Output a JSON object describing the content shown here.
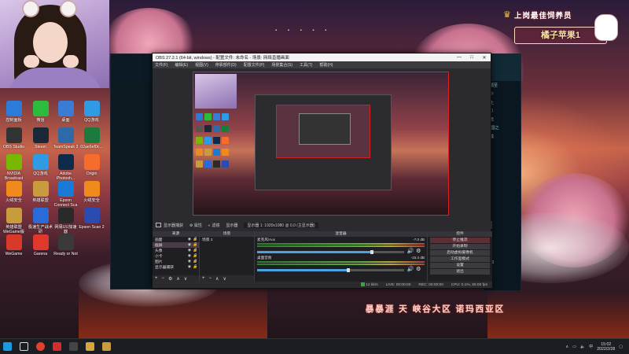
{
  "desktop": {
    "icons": [
      {
        "label": "控制面板",
        "icon": "control-panel-icon",
        "color": "#2b7bd8"
      },
      {
        "label": "微信",
        "icon": "wechat-icon",
        "color": "#2dbb3c"
      },
      {
        "label": "桌面",
        "icon": "desktop-icon",
        "color": "#3a7bd5"
      },
      {
        "label": "QQ游戏",
        "icon": "qq-game-icon",
        "color": "#2f9be4"
      },
      {
        "label": "OBS Studio",
        "icon": "obs-icon",
        "color": "#333333"
      },
      {
        "label": "Steam",
        "icon": "steam-icon",
        "color": "#1b2838"
      },
      {
        "label": "TeamSpeak 3",
        "icon": "teamspeak-icon",
        "color": "#2d6aa7"
      },
      {
        "label": "02ae6ef0c...",
        "icon": "excel-file-icon",
        "color": "#1d7a3d"
      },
      {
        "label": "NVIDIA Broadcast",
        "icon": "nvidia-icon",
        "color": "#76b900"
      },
      {
        "label": "QQ游戏",
        "icon": "qq-game-icon",
        "color": "#2f9be4"
      },
      {
        "label": "Adobe Photosh...",
        "icon": "photoshop-icon",
        "color": "#0f2b4c"
      },
      {
        "label": "Origin",
        "icon": "origin-icon",
        "color": "#f56c2d"
      },
      {
        "label": "火绒安全",
        "icon": "huorong-icon",
        "color": "#f08a1c"
      },
      {
        "label": "英雄联盟",
        "icon": "lol-icon",
        "color": "#c89b3c"
      },
      {
        "label": "Epson Connect Sca",
        "icon": "edge-icon",
        "color": "#1a7ad8"
      },
      {
        "label": "火绒安全",
        "icon": "huorong-icon",
        "color": "#f08a1c"
      },
      {
        "label": "英雄联盟 WeGame版",
        "icon": "lol-icon",
        "color": "#c89b3c"
      },
      {
        "label": "极速生产战术研",
        "icon": "monitor-icon",
        "color": "#2b6bd8"
      },
      {
        "label": "网易UU加速器",
        "icon": "uu-icon",
        "color": "#2a2a2a"
      },
      {
        "label": "Epson Scan 2",
        "icon": "epson-scan-icon",
        "color": "#2b4bb0"
      },
      {
        "label": "WeGame",
        "icon": "wegame-icon",
        "color": "#d83a2a"
      },
      {
        "label": "Garena",
        "icon": "garena-icon",
        "color": "#e0382a"
      },
      {
        "label": "Ready or Not",
        "icon": "ready-or-not-icon",
        "color": "#3a3a3a"
      }
    ]
  },
  "overlay": {
    "brand_title": "上岗最佳饲养员",
    "brand_name": "橘子苹果1",
    "caption": "暴暴涯 天  峡谷大区   诺玛西亚区",
    "top_strip": "▪ ▪ ▪ ▪ ▪"
  },
  "obs": {
    "title": "OBS 27.2.1 (64-bit, windows) - 配置文件: 未命名 - 场景: 网络直播画面",
    "menu": [
      "文件(F)",
      "编辑(E)",
      "视图(V)",
      "停靠部件(D)",
      "配置文件(P)",
      "场景集合(S)",
      "工具(T)",
      "帮助(H)"
    ],
    "toolbar": {
      "source_label": "显示器捕获",
      "properties": "属性",
      "filters": "滤镜",
      "display_label": "显示器",
      "display_value": "显示器 1: 1920x1080 @ 0,0 (主显示器)"
    },
    "scenes_header": "来源",
    "sources": [
      {
        "name": "画面"
      },
      {
        "name": "截屏"
      },
      {
        "name": "头像"
      },
      {
        "name": "小卡"
      },
      {
        "name": "图片"
      },
      {
        "name": "显示器捕获"
      }
    ],
    "scene_list_header": "场景",
    "scene_item": "场景 2",
    "mixer_header": "混音器",
    "mixer": [
      {
        "name": "麦克风/Aux",
        "db": "-7.0 dB",
        "level": 0.78
      },
      {
        "name": "桌面音频",
        "db": "-15.4 dB",
        "level": 0.62
      }
    ],
    "controls_header": "控件",
    "controls": [
      "停止推流",
      "开始录制",
      "启动虚拟摄像机",
      "工作室模式",
      "设置",
      "退出"
    ],
    "status": {
      "live": "LIVE: 00:00:00",
      "rec": "REC: 00:00:00",
      "cpu": "CPU: 0.1%, 60.00 fps",
      "kbps": "12 kb/s"
    },
    "controls_title_bar": [
      "—",
      "□",
      "✕"
    ]
  },
  "game_window": {
    "side_texts": [
      "不顺至",
      "年少",
      "以上",
      "(25)",
      "队伍",
      "(三国之",
      "达成",
      "V1.0"
    ]
  },
  "taskbar": {
    "apps": [
      "windows-start",
      "search",
      "chrome",
      "qq-music",
      "obs",
      "file-explorer",
      "lol"
    ],
    "app_colors": [
      "#1a9ae0",
      "#ffffff",
      "#e0412d",
      "#d62b2b",
      "#444444",
      "#d7a63a",
      "#c89b3c"
    ],
    "tray_lang": "中",
    "time": "15:02",
    "date": "2022/2/28"
  }
}
